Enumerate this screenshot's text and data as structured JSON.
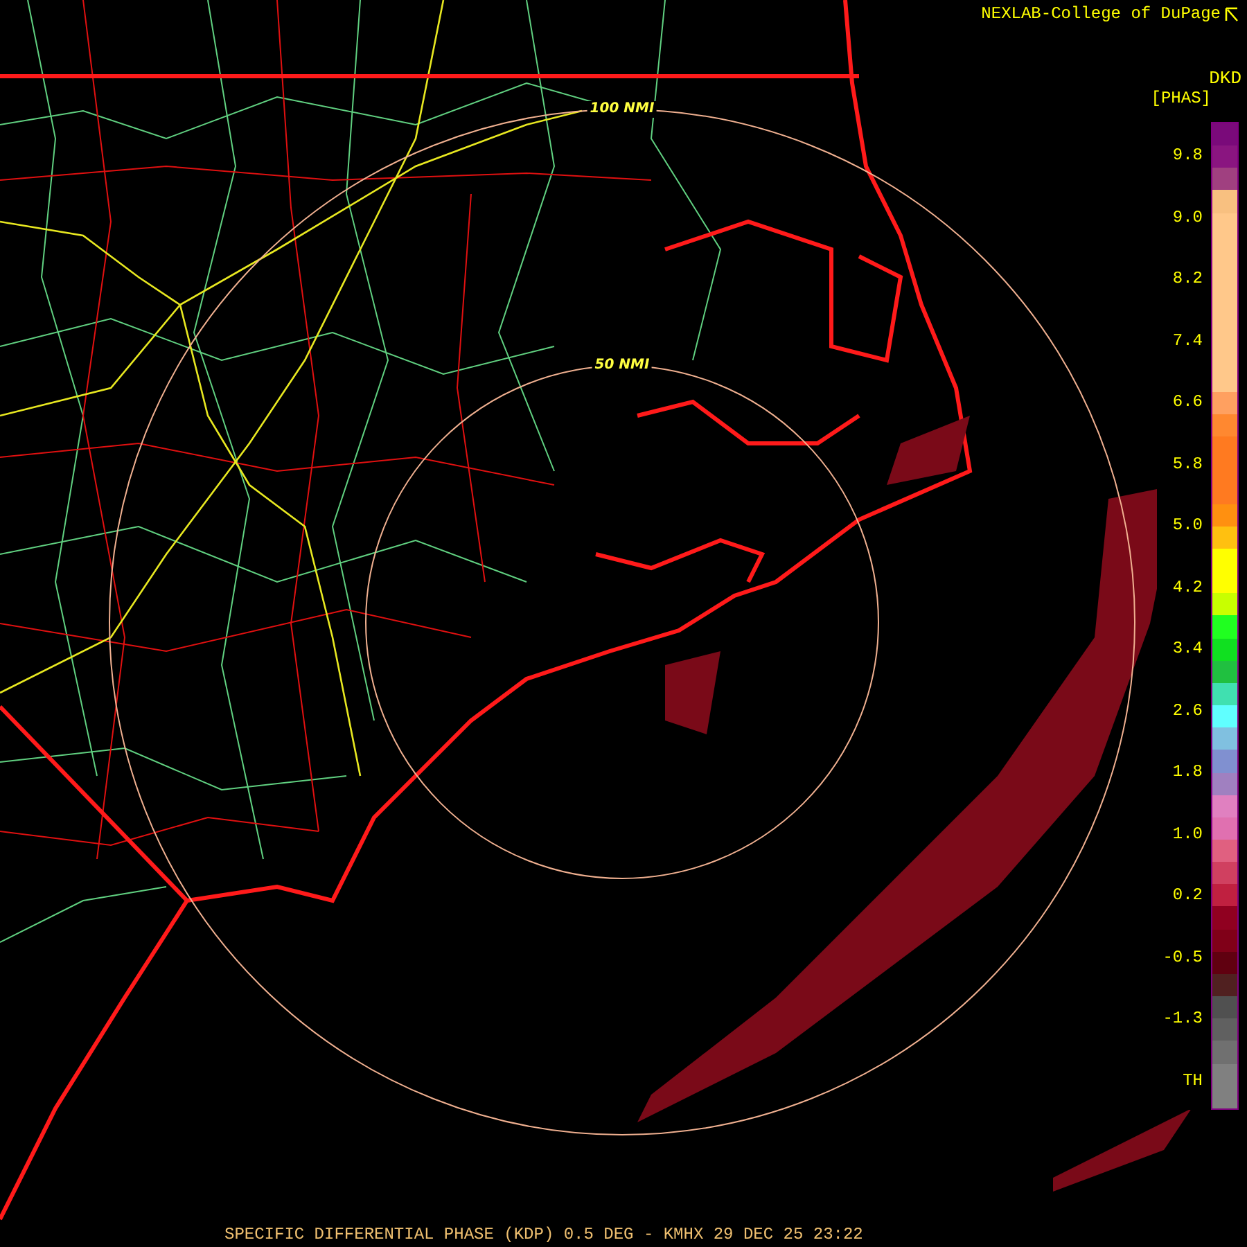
{
  "header": {
    "credit": "NEXLAB-College of DuPage"
  },
  "legend": {
    "product": "DKD",
    "unit": "[PHAS]",
    "labels": [
      "9.8",
      "9.0",
      "8.2",
      "7.4",
      "6.6",
      "5.8",
      "5.0",
      "4.2",
      "3.4",
      "2.6",
      "1.8",
      "1.0",
      "0.2",
      "-0.5",
      "-1.3",
      "TH"
    ]
  },
  "map": {
    "range_rings": [
      {
        "label": "100 NMI"
      },
      {
        "label": "50 NMI"
      }
    ]
  },
  "footer": {
    "title": "SPECIFIC DIFFERENTIAL PHASE (KDP) 0.5 DEG - KMHX 29 DEC 25 23:22"
  }
}
